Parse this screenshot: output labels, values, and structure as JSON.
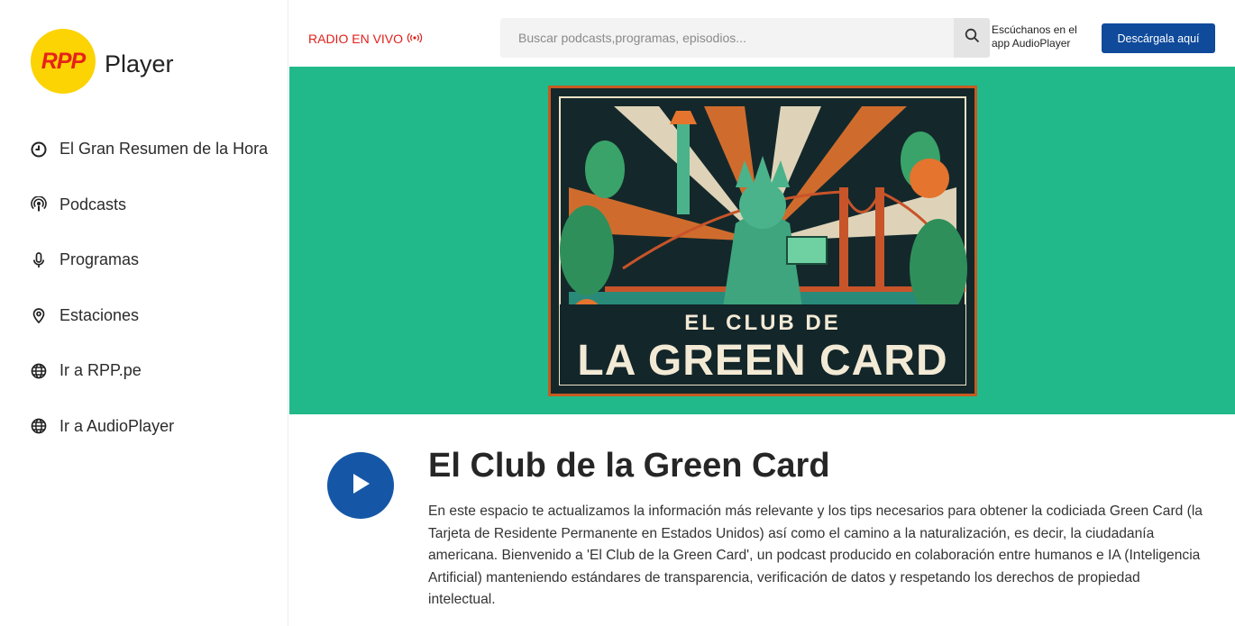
{
  "brand": {
    "logo_mark": "RPP",
    "logo_text": "Player",
    "accent_yellow": "#fcd303",
    "accent_red": "#e5231b"
  },
  "sidebar": {
    "items": [
      {
        "label": "El Gran Resumen de la Hora",
        "icon": "clock-icon"
      },
      {
        "label": "Podcasts",
        "icon": "podcast-icon"
      },
      {
        "label": "Programas",
        "icon": "microphone-icon"
      },
      {
        "label": "Estaciones",
        "icon": "location-pin-icon"
      },
      {
        "label": "Ir a RPP.pe",
        "icon": "globe-icon"
      },
      {
        "label": "Ir a AudioPlayer",
        "icon": "globe-icon"
      }
    ]
  },
  "header": {
    "radio_live": "RADIO EN VIVO",
    "search_placeholder": "Buscar podcasts,programas, episodios...",
    "app_promo": "Escúchanos en el app AudioPlayer",
    "download_button": "Descárgala aquí",
    "download_color": "#0f4a9b"
  },
  "hero": {
    "background": "#21b98a",
    "cover_line1": "EL CLUB DE",
    "cover_line2": "LA GREEN CARD"
  },
  "podcast": {
    "title": "El Club de la Green Card",
    "description": "En este espacio te actualizamos la información más relevante y los tips necesarios para obtener la codiciada Green Card (la Tarjeta de Residente Permanente en Estados Unidos) así como el camino a la naturalización, es decir,  la ciudadanía americana. Bienvenido a 'El Club de la Green Card', un podcast producido en colaboración entre humanos e IA (Inteligencia Artificial) manteniendo estándares de transparencia, verificación de datos y respetando los derechos de propiedad intelectual."
  }
}
